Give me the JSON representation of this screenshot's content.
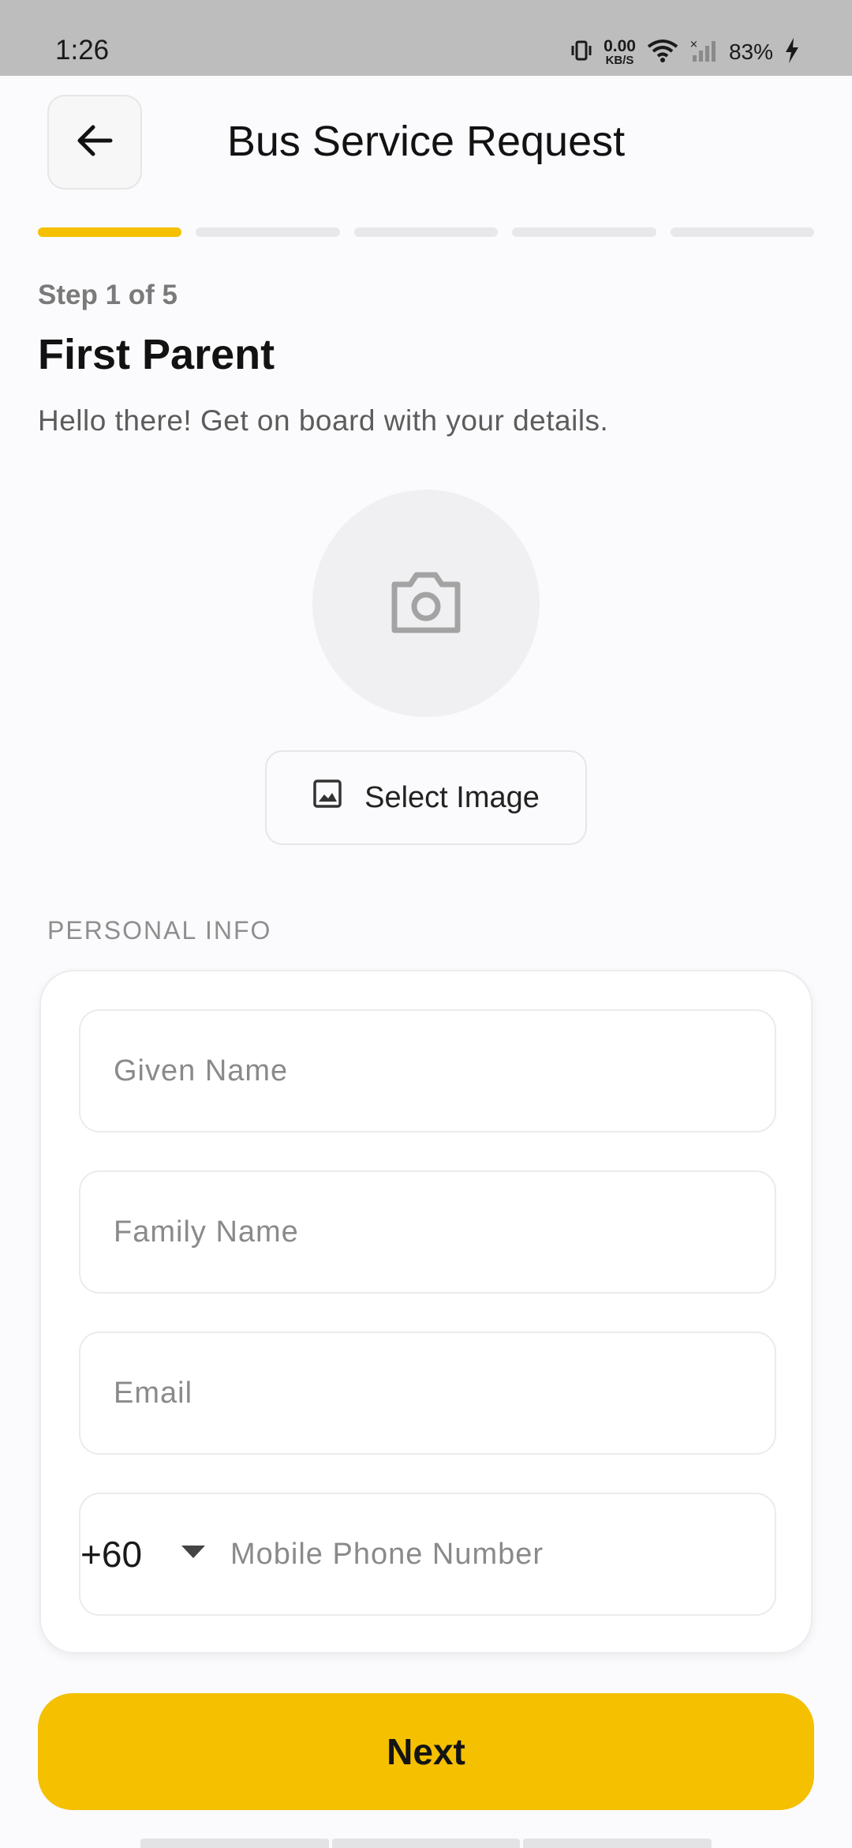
{
  "status_bar": {
    "time": "1:26",
    "net_speed_value": "0.00",
    "net_speed_unit": "KB/S",
    "battery": "83%",
    "icons": [
      "vibrate-icon",
      "wifi-icon",
      "signal-icon",
      "charging-icon"
    ]
  },
  "header": {
    "title": "Bus Service Request",
    "back_icon": "arrow-left-icon"
  },
  "progress": {
    "current_step": 1,
    "total_steps": 5,
    "accent_color": "#f4c000"
  },
  "step": {
    "label": "Step 1 of 5",
    "title": "First Parent",
    "subtitle": "Hello there! Get on board with your details."
  },
  "photo": {
    "icon": "camera-icon",
    "select_button_label": "Select Image",
    "select_button_icon": "image-icon"
  },
  "personal_info": {
    "group_label": "PERSONAL INFO",
    "given_name_placeholder": "Given Name",
    "family_name_placeholder": "Family Name",
    "email_placeholder": "Email",
    "country_code": "+60",
    "phone_placeholder": "Mobile Phone Number"
  },
  "actions": {
    "next_label": "Next"
  }
}
